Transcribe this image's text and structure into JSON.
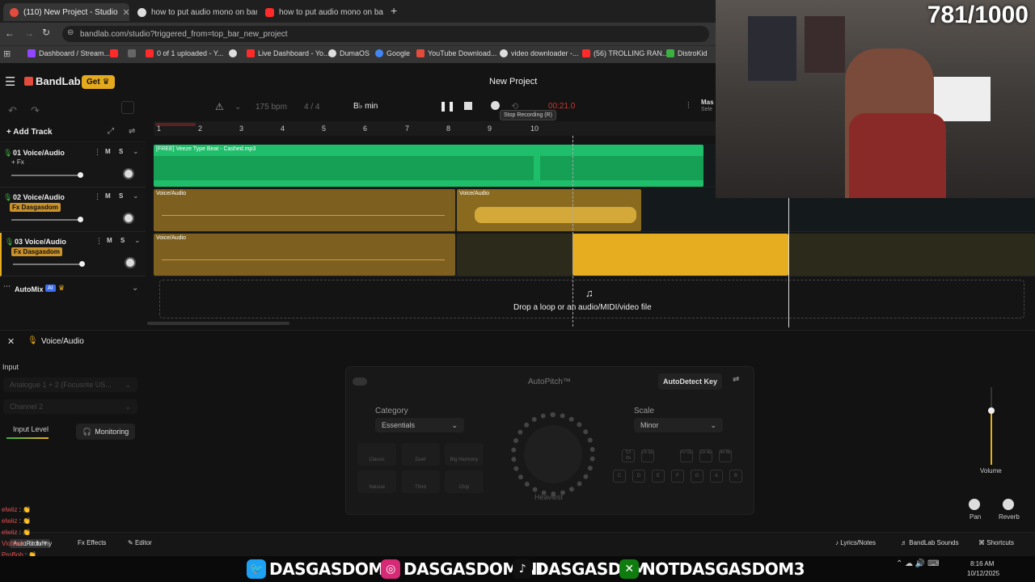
{
  "browser": {
    "tabs": [
      {
        "label": "(110) New Project - Studio",
        "color": "#e34b3c"
      },
      {
        "label": "how to put audio mono on ban",
        "color": "#e8e8e8"
      },
      {
        "label": "how to put audio mono on ba",
        "color": "#ff2a2a"
      }
    ],
    "url": "bandlab.com/studio?triggered_from=top_bar_new_project",
    "bookmarks": [
      "Dashboard / Stream...",
      "0 of 1 uploaded - Y...",
      "Live Dashboard - Yo...",
      "DumaOS",
      "Google",
      "YouTube Download...",
      "video downloader -...",
      "(56) TROLLING RAN...",
      "DistroKid"
    ]
  },
  "app": {
    "brand": "BandLab",
    "get_label": "Get",
    "project_title": "New Project",
    "bpm": "175",
    "bpm_unit": "bpm",
    "time_sig": "4 / 4",
    "key": "B♭ min",
    "time_display": "00:21.0",
    "tooltip": "Stop Recording (R)",
    "master_label": "Mas",
    "master_sub": "Sele",
    "add_track": "Add Track",
    "ruler": [
      "1",
      "2",
      "3",
      "4",
      "5",
      "6",
      "7",
      "8",
      "9",
      "10"
    ],
    "tracks": [
      {
        "num": "01",
        "name": "Voice/Audio",
        "fx": "+ Fx",
        "fx_style": "plain",
        "m": "M",
        "s": "S"
      },
      {
        "num": "02",
        "name": "Voice/Audio",
        "fx": "Fx Dasgasdom",
        "fx_style": "badge",
        "m": "M",
        "s": "S"
      },
      {
        "num": "03",
        "name": "Voice/Audio",
        "fx": "Fx Dasgasdom",
        "fx_style": "badge",
        "m": "M",
        "s": "S"
      }
    ],
    "clips": {
      "beat": "[FREE] Veeze Type Beat - Cashed.mp3",
      "voice": "Voice/Audio"
    },
    "automix": "AutoMix",
    "automix_badge": "AI",
    "dropzone": "Drop a loop or an audio/MIDI/video file"
  },
  "bottom": {
    "title": "Voice/Audio",
    "input_label": "Input",
    "input_device": "Analogue 1 + 2 (Focusrite US...",
    "channel": "Channel 2",
    "input_level": "Input Level",
    "monitoring": "Monitoring",
    "autopitch": {
      "title": "AutoPitch™",
      "autodetect": "AutoDetect Key",
      "category_label": "Category",
      "category_value": "Essentials",
      "scale_label": "Scale",
      "scale_value": "Minor",
      "effects": [
        "Classic",
        "Duet",
        "Big Harmony",
        "Natural",
        "Third",
        "Chip"
      ],
      "knob_label": "Heaviest",
      "keys": [
        "C",
        "D",
        "E",
        "F",
        "G",
        "A",
        "B"
      ],
      "keys_top": [
        "C#\nDb",
        "D#\nEb",
        "",
        "F#\nGb",
        "G#\nAb",
        "A#\nBb"
      ]
    },
    "volume_label": "Volume",
    "pan_label": "Pan",
    "reverb_label": "Reverb"
  },
  "statusbar": {
    "autopitch_tab": "AutoPitch™",
    "effects_tab": "Effects",
    "editor_tab": "Editor",
    "lyrics": "Lyrics/Notes",
    "sounds": "BandLab Sounds",
    "shortcuts": "Shortcuts",
    "clock_time": "8:16 AM",
    "clock_date": "10/12/2025"
  },
  "chat": [
    {
      "user": "elwiiz",
      "msg": ": 👏"
    },
    {
      "user": "elwiiz",
      "msg": ": 👏"
    },
    {
      "user": "elwiiz",
      "msg": ": 👏"
    },
    {
      "user": "Viohlee",
      "msg": ": ur funny"
    },
    {
      "user": "ProBob",
      "msg": ": 👏"
    },
    {
      "user": "blackwidow",
      "msg": ": i'm fekin dead"
    }
  ],
  "overlay": {
    "counter": "781/1000",
    "socials": [
      {
        "icon": "twitter-icon",
        "label": "DASGASDOM3",
        "color": "#1da1f2"
      },
      {
        "icon": "instagram-icon",
        "label": "DASGASDOMINI",
        "color": "#d62976"
      },
      {
        "icon": "tiktok-icon",
        "label": "DASGASD3M",
        "color": "#111111"
      },
      {
        "icon": "xbox-icon",
        "label": "NOTDASGASDOM3",
        "color": "#107c10"
      }
    ]
  },
  "colors": {
    "green_clip": "#1fbe6a",
    "orange_clip": "#8a6a1e",
    "orange_bright": "#e5ad1f",
    "accent": "#e34b3c"
  }
}
